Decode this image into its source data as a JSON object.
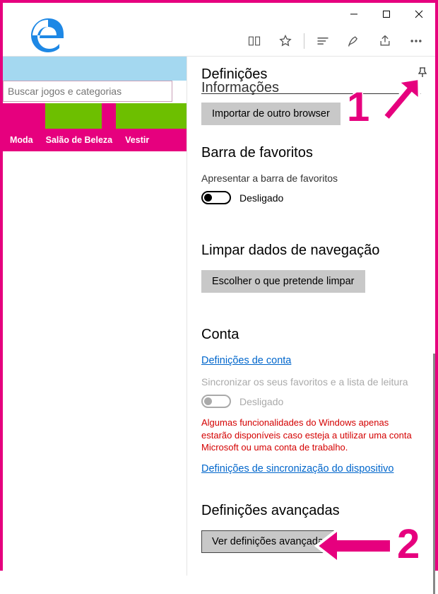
{
  "page": {
    "search_placeholder": "Buscar jogos e categorias",
    "nav": [
      "Moda",
      "Salão de Beleza",
      "Vestir"
    ]
  },
  "panel": {
    "title": "Definições",
    "cutoff_title": "Informações",
    "import_btn": "Importar de outro browser",
    "fav_header": "Barra de favoritos",
    "fav_toggle_label": "Apresentar a barra de favoritos",
    "fav_toggle_state": "Desligado",
    "clear_header": "Limpar dados de navegação",
    "clear_btn": "Escolher o que pretende limpar",
    "account_header": "Conta",
    "account_link": "Definições de conta",
    "sync_label": "Sincronizar os seus favoritos e a lista de leitura",
    "sync_state": "Desligado",
    "sync_warning": "Algumas funcionalidades do Windows apenas estarão disponíveis caso esteja a utilizar uma conta Microsoft ou uma conta de trabalho.",
    "sync_link": "Definições de sincronização do dispositivo",
    "advanced_header": "Definições avançadas",
    "advanced_btn": "Ver definições avançadas"
  },
  "annotations": {
    "one": "1",
    "two": "2"
  }
}
